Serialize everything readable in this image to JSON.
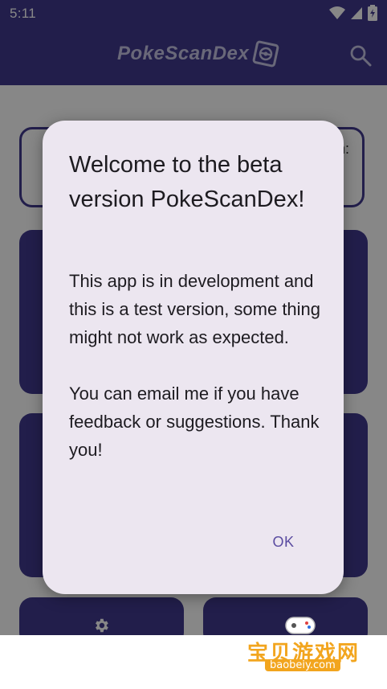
{
  "status_bar": {
    "time": "5:11"
  },
  "app_bar": {
    "logo_text": "PokeScanDex"
  },
  "background": {
    "top_card_text": "n:"
  },
  "dialog": {
    "title": "Welcome to the beta version PokeScanDex!",
    "body_paragraph_1": "This app is in development and this is a test version, some thing might not work as expected.",
    "body_paragraph_2": "You can email me if you have feedback or suggestions. Thank you!",
    "ok_label": "OK"
  },
  "watermark": {
    "text": "宝贝游戏网",
    "url": "baobeiy.com"
  },
  "icons": {
    "wifi": "wifi-icon",
    "signal": "signal-icon",
    "battery": "battery-icon",
    "search": "search-icon",
    "settings": "gear-icon",
    "logo": "pokeball-logo-icon"
  },
  "colors": {
    "primary": "#40398f",
    "dialog_bg": "#ece6f0",
    "accent_text": "#5a4ba0",
    "watermark": "#f2a51e"
  }
}
